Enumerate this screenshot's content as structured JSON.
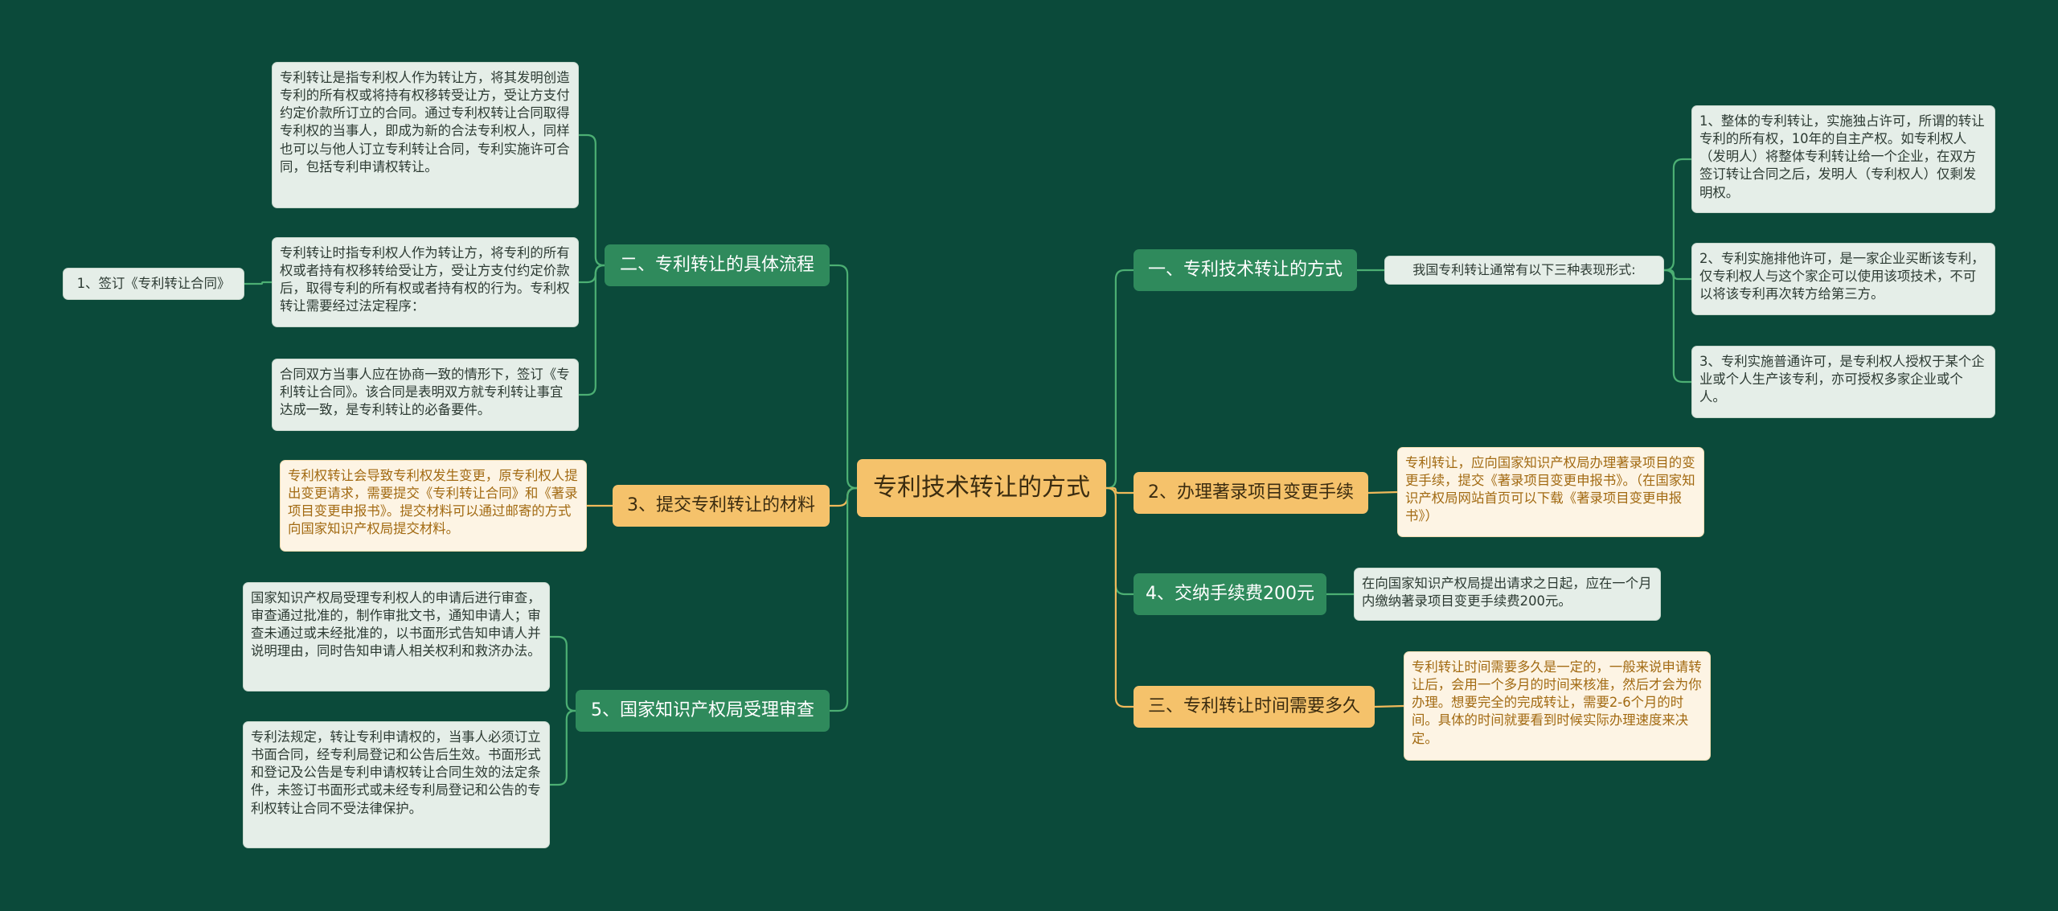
{
  "root": {
    "label": "专利技术转让的方式"
  },
  "branches": {
    "b1": {
      "label": "一、专利技术转让的方式"
    },
    "b2": {
      "label": "2、办理著录项目变更手续"
    },
    "b3": {
      "label": "4、交纳手续费200元"
    },
    "b4": {
      "label": "三、专利转让时间需要多久"
    },
    "b5": {
      "label": "二、专利转让的具体流程"
    },
    "b6": {
      "label": "3、提交专利转让的材料"
    },
    "b7": {
      "label": "5、国家知识产权局受理审查"
    }
  },
  "leaves": {
    "b1_intro": "我国专利转让通常有以下三种表现形式:",
    "b1_1": "1、整体的专利转让，实施独占许可，所谓的转让专利的所有权，10年的自主产权。如专利权人（发明人）将整体专利转让给一个企业，在双方签订转让合同之后，发明人（专利权人）仅剩发明权。",
    "b1_2": "2、专利实施排他许可，是一家企业买断该专利，仅专利权人与这个家企可以使用该项技术，不可以将该专利再次转方给第三方。",
    "b1_3": "3、专利实施普通许可，是专利权人授权于某个企业或个人生产该专利，亦可授权多家企业或个人。",
    "b2_1": "专利转让，应向国家知识产权局办理著录项目的变更手续，提交《著录项目变更申报书》。（在国家知识产权局网站首页可以下载《著录项目变更申报书》）",
    "b3_1": "在向国家知识产权局提出请求之日起，应在一个月内缴纳著录项目变更手续费200元。",
    "b4_1": "专利转让时间需要多久是一定的，一般来说申请转让后，会用一个多月的时间来核准，然后才会为你办理。想要完全的完成转让，需要2-6个月的时间。具体的时间就要看到时候实际办理速度来决定。",
    "b5_1": "专利转让是指专利权人作为转让方，将其发明创造专利的所有权或将持有权移转受让方，受让方支付约定价款所订立的合同。通过专利权转让合同取得专利权的当事人，即成为新的合法专利权人，同样也可以与他人订立专利转让合同，专利实施许可合同，包括专利申请权转让。",
    "b5_2": "专利转让时指专利权人作为转让方，将专利的所有权或者持有权移转给受让方，受让方支付约定价款后，取得专利的所有权或者持有权的行为。专利权转让需要经过法定程序：",
    "b5_2_1": "1、签订《专利转让合同》",
    "b5_3": "合同双方当事人应在协商一致的情形下，签订《专利转让合同》。该合同是表明双方就专利转让事宜达成一致，是专利转让的必备要件。",
    "b6_1": "专利权转让会导致专利权发生变更，原专利权人提出变更请求，需要提交《专利转让合同》和《著录项目变更申报书》。提交材料可以通过邮寄的方式向国家知识产权局提交材料。",
    "b7_1": "国家知识产权局受理专利权人的申请后进行审查，审查通过批准的，制作审批文书，通知申请人；审查未通过或未经批准的，以书面形式告知申请人并说明理由，同时告知申请人相关权利和救济办法。",
    "b7_2": "专利法规定，转让专利申请权的，当事人必须订立书面合同，经专利局登记和公告后生效。书面形式和登记及公告是专利申请权转让合同生效的法定条件，未签订书面形式或未经专利局登记和公告的专利权转让合同不受法律保护。"
  },
  "colors": {
    "background": "#0b4a3a",
    "root": "#f5c26b",
    "branch_green": "#2f8a5c",
    "branch_orange": "#f5c26b",
    "leaf_green": "#e5eee8",
    "leaf_warm": "#fdf4e4",
    "line_green": "#4caf73",
    "line_orange": "#f0b95a"
  }
}
